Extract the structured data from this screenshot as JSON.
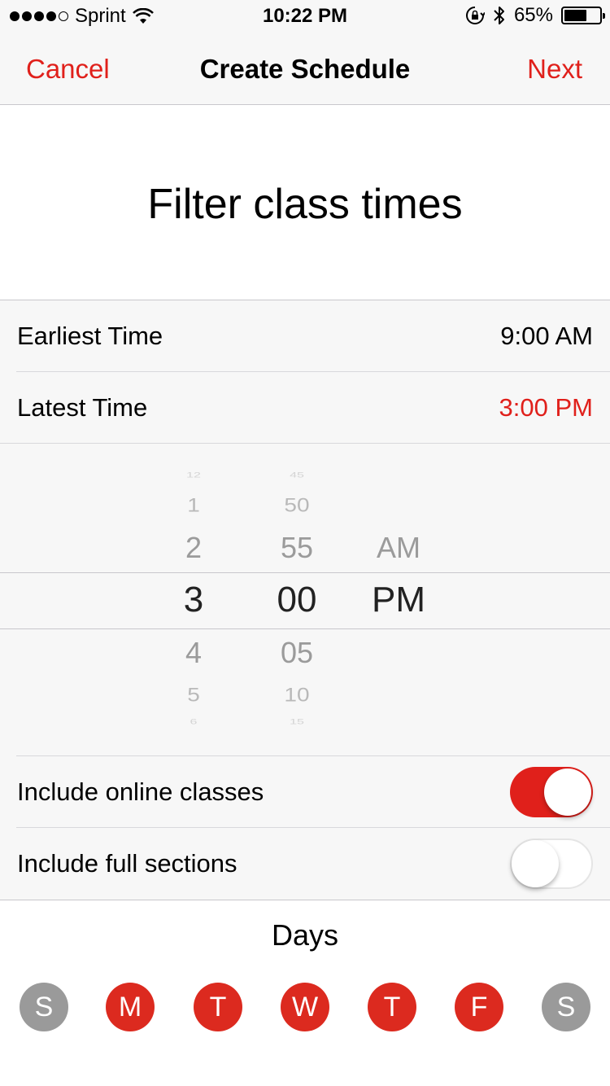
{
  "status_bar": {
    "carrier": "Sprint",
    "time": "10:22 PM",
    "battery": "65%",
    "battery_level": 0.65,
    "signal_bars_filled": 4,
    "signal_bars_total": 5
  },
  "nav": {
    "cancel_label": "Cancel",
    "title": "Create Schedule",
    "next_label": "Next"
  },
  "heading": "Filter class times",
  "rows": {
    "earliest": {
      "label": "Earliest Time",
      "value": "9:00 AM"
    },
    "latest": {
      "label": "Latest Time",
      "value": "3:00 PM"
    }
  },
  "picker": {
    "hours": [
      "12",
      "1",
      "2",
      "3",
      "4",
      "5",
      "6"
    ],
    "minutes": [
      "45",
      "50",
      "55",
      "00",
      "05",
      "10",
      "15"
    ],
    "periods": [
      "AM",
      "PM"
    ],
    "selected_hour": "3",
    "selected_minute": "00",
    "selected_period": "PM"
  },
  "toggles": {
    "online": {
      "label": "Include online classes",
      "on": true
    },
    "full": {
      "label": "Include full sections",
      "on": false
    }
  },
  "days": {
    "title": "Days",
    "items": [
      {
        "letter": "S",
        "selected": false
      },
      {
        "letter": "M",
        "selected": true
      },
      {
        "letter": "T",
        "selected": true
      },
      {
        "letter": "W",
        "selected": true
      },
      {
        "letter": "T",
        "selected": true
      },
      {
        "letter": "F",
        "selected": true
      },
      {
        "letter": "S",
        "selected": false
      }
    ]
  },
  "colors": {
    "accent": "#e0201b",
    "day_selected": "#dc2a1f",
    "day_unselected": "#9a9a9a"
  }
}
